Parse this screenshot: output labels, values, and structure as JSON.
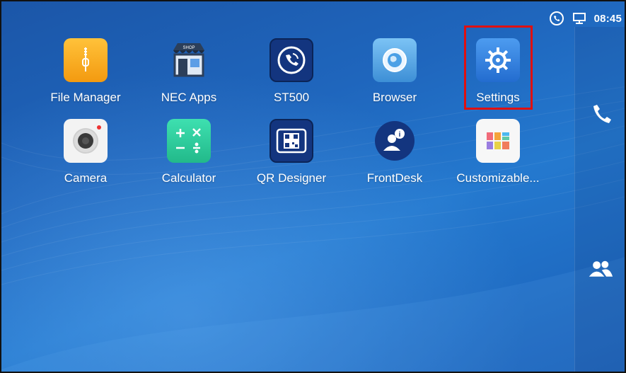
{
  "status_bar": {
    "time": "08:45",
    "icons": [
      "call-status-icon",
      "desk-phone-icon"
    ]
  },
  "apps": [
    {
      "label": "File Manager",
      "icon": "folder-zip-icon",
      "color": "#f7a520"
    },
    {
      "label": "NEC Apps",
      "icon": "store-icon",
      "color": "#4a6fa5"
    },
    {
      "label": "ST500",
      "icon": "phone-circle-icon",
      "color": "#1a3f8f"
    },
    {
      "label": "Browser",
      "icon": "globe-icon",
      "color": "#4fa3e0"
    },
    {
      "label": "Settings",
      "icon": "gear-icon",
      "color": "#2f7fe0"
    },
    {
      "label": "Camera",
      "icon": "camera-icon",
      "color": "#f0f0f0"
    },
    {
      "label": "Calculator",
      "icon": "calculator-icon",
      "color": "#2ecc9a"
    },
    {
      "label": "QR Designer",
      "icon": "qr-code-icon",
      "color": "#1a3f8f"
    },
    {
      "label": "FrontDesk",
      "icon": "frontdesk-icon",
      "color": "#1a3f8f"
    },
    {
      "label": "Customizable...",
      "icon": "widget-grid-icon",
      "color": "#ffffff"
    }
  ],
  "dock": {
    "items": [
      "phone-icon",
      "contacts-icon"
    ]
  },
  "highlighted_app": "Settings",
  "highlight_color": "#e01010"
}
